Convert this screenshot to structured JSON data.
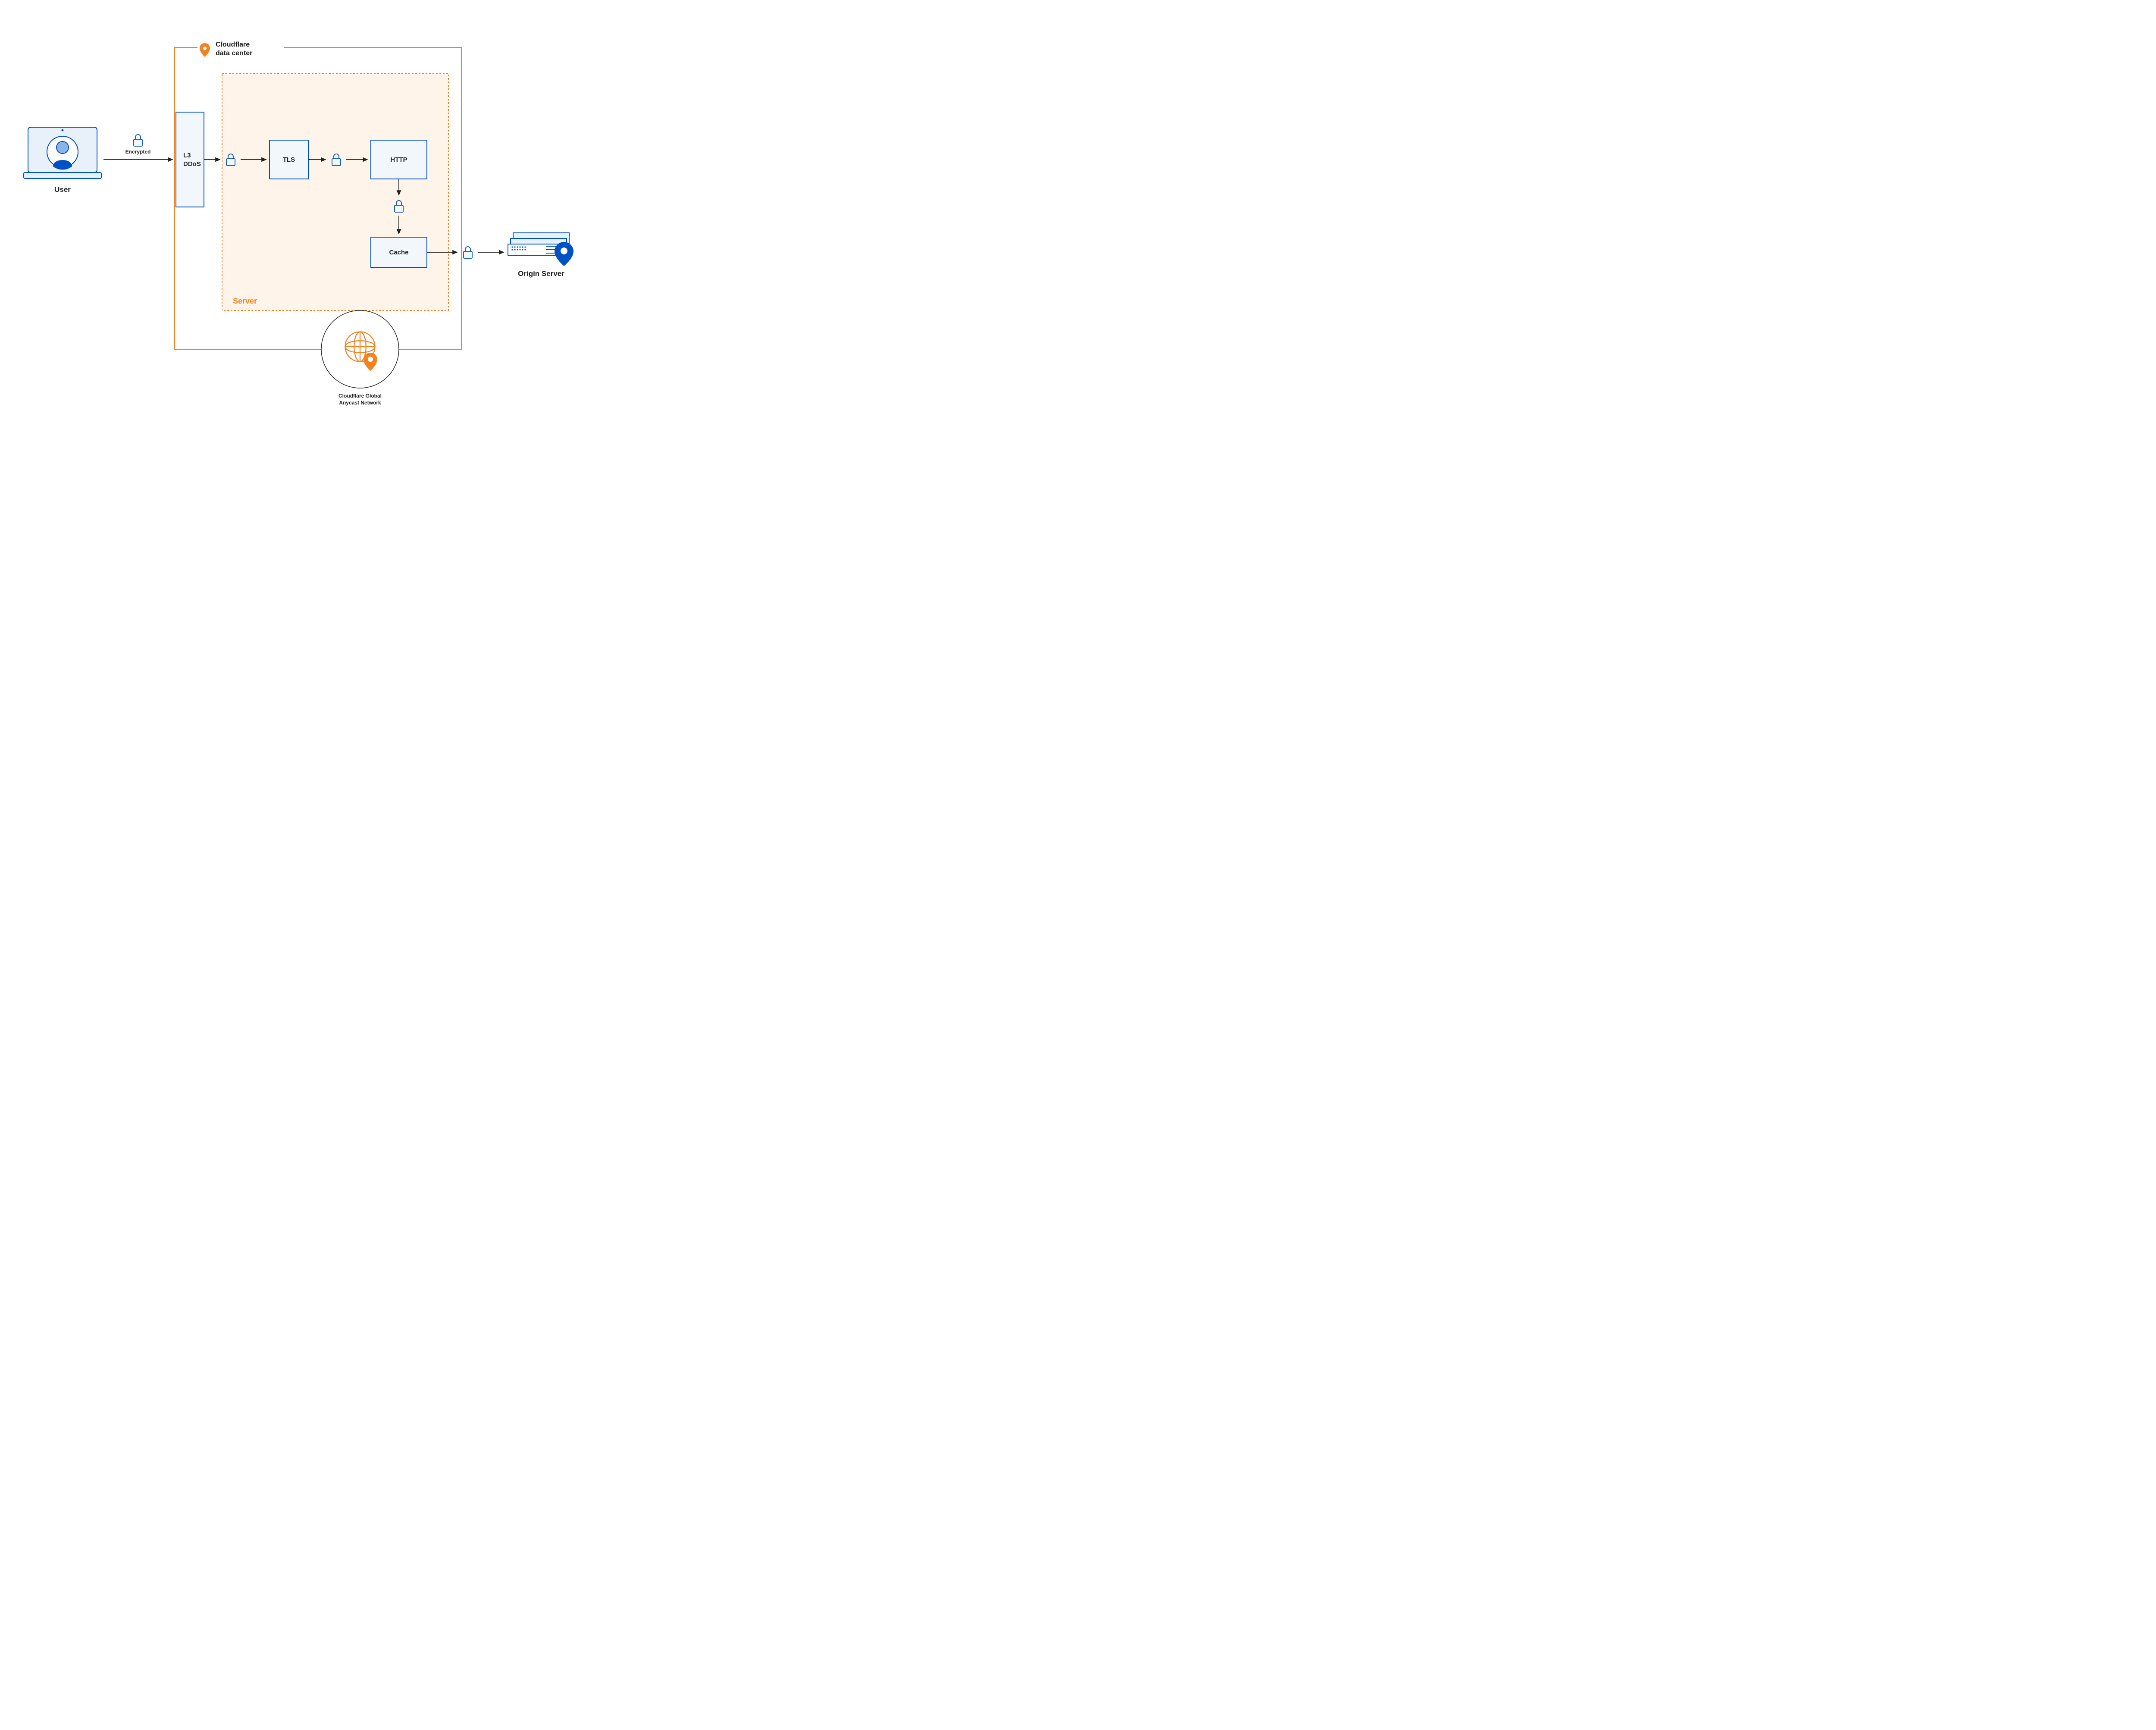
{
  "diagram": {
    "title": {
      "line1": "Cloudflare",
      "line2": "data center"
    },
    "user": {
      "label": "User",
      "arrow": "Encrypted"
    },
    "nodes": {
      "l3ddos": {
        "line1": "L3",
        "line2": "DDoS"
      },
      "tls": "TLS",
      "http": "HTTP",
      "cache": "Cache"
    },
    "server": "Server",
    "origin": "Origin Server",
    "anycast": {
      "line1": "Cloudflare Global",
      "line2": "Anycast Network"
    }
  },
  "colors": {
    "orange": "#f6821f",
    "blue": "#0051C3",
    "darkblue": "#003E8A",
    "lightblue": "#e8f1f9"
  }
}
